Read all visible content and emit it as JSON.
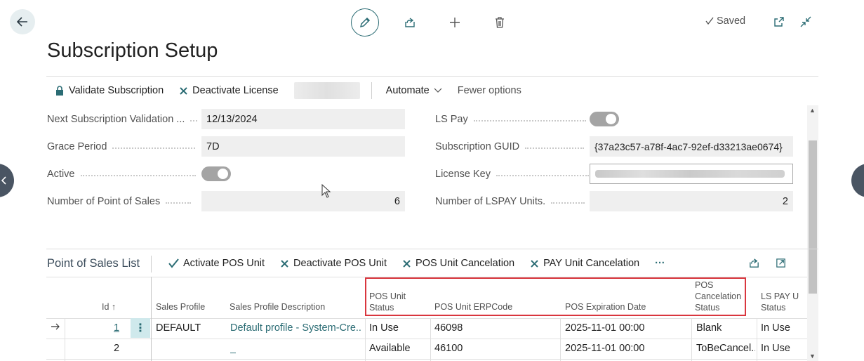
{
  "window": {
    "saved_label": "Saved"
  },
  "page": {
    "title": "Subscription Setup"
  },
  "actions": {
    "validate": "Validate Subscription",
    "deactivate": "Deactivate License",
    "automate": "Automate",
    "fewer_options": "Fewer options"
  },
  "fields": {
    "next_validation": {
      "label": "Next Subscription Validation ...",
      "value": "12/13/2024"
    },
    "grace_period": {
      "label": "Grace Period",
      "value": "7D"
    },
    "active": {
      "label": "Active",
      "value": "on"
    },
    "num_pos": {
      "label": "Number of Point of Sales",
      "value": "6"
    },
    "ls_pay": {
      "label": "LS Pay",
      "value": "on"
    },
    "guid": {
      "label": "Subscription GUID",
      "value": "{37a23c57-a78f-4ac7-92ef-d33213ae0674}"
    },
    "license_key": {
      "label": "License Key"
    },
    "num_lspay": {
      "label": "Number of LSPAY Units.",
      "value": "2"
    }
  },
  "pos_list": {
    "title": "Point of Sales List",
    "actions": [
      "Activate POS Unit",
      "Deactivate POS Unit",
      "POS Unit Cancelation",
      "PAY Unit Cancelation"
    ],
    "more": "···",
    "columns": {
      "id": "Id",
      "sort_arrow": "↑",
      "sales_profile": "Sales Profile",
      "sales_profile_desc": "Sales Profile Description",
      "pos_unit_status": "POS Unit Status",
      "pos_unit_erpcode": "POS Unit ERPCode",
      "pos_expiration": "POS Expiration Date",
      "pos_cancel_status": "POS Cancelation Status",
      "ls_pay_status": "LS PAY U Status"
    },
    "rows": [
      {
        "id": "1",
        "sales_profile": "DEFAULT",
        "desc": "Default profile - System-Cre...",
        "status": "In Use",
        "erpcode": "46098",
        "expiration": "2025-11-01 00:00",
        "cancel": "Blank",
        "lspay": "In Use"
      },
      {
        "id": "2",
        "sales_profile": "",
        "desc": "_",
        "status": "Available",
        "erpcode": "46100",
        "expiration": "2025-11-01 00:00",
        "cancel": "ToBeCancel...",
        "lspay": "In Use"
      }
    ]
  },
  "colors": {
    "accent": "#2b6c74",
    "highlight_border": "#d9363e"
  }
}
